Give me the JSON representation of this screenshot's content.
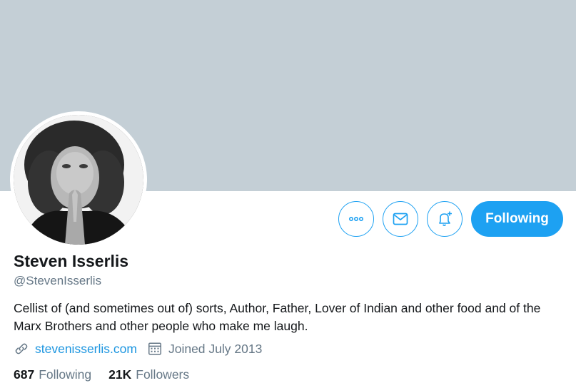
{
  "profile": {
    "display_name": "Steven Isserlis",
    "handle": "@StevenIsserlis",
    "bio": "Cellist of (and sometimes out of) sorts, Author, Father, Lover of Indian and other food and of the Marx Brothers and other people who make me laugh.",
    "website": "stevenisserlis.com",
    "joined": "Joined July 2013"
  },
  "stats": {
    "following_count": "687",
    "following_label": "Following",
    "followers_count": "21K",
    "followers_label": "Followers"
  },
  "actions": {
    "more_icon": "more-icon",
    "message_icon": "envelope-icon",
    "notify_icon": "bell-plus-icon",
    "following_label": "Following"
  },
  "colors": {
    "accent": "#1da1f2",
    "banner": "#c4cfd6",
    "secondary_text": "#657786",
    "link": "#1b95e0"
  }
}
